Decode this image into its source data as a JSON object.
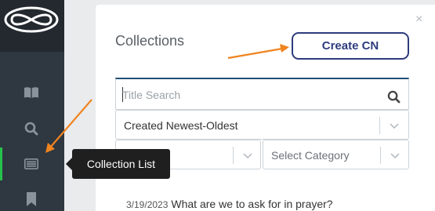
{
  "sidebar": {
    "items": [
      {
        "icon": "book-open-icon"
      },
      {
        "icon": "search-icon"
      },
      {
        "icon": "list-icon",
        "active": true
      },
      {
        "icon": "bookmark-icon"
      }
    ],
    "active_color": "#27c24c"
  },
  "panel": {
    "title": "Collections",
    "close": "×",
    "create_label": "Create CN",
    "search": {
      "placeholder": "Title Search"
    },
    "sort": {
      "value": "Created Newest-Oldest"
    },
    "filter": {
      "value": ""
    },
    "category": {
      "placeholder": "Select Category"
    },
    "items": [
      {
        "date": "3/19/2023",
        "title": "What are we to ask for in prayer?"
      }
    ]
  },
  "tooltip": {
    "text": "Collection List"
  },
  "colors": {
    "brand": "#2e3c7e",
    "annotation_arrow": "#f0841f",
    "sidebar": "#2f3740"
  }
}
